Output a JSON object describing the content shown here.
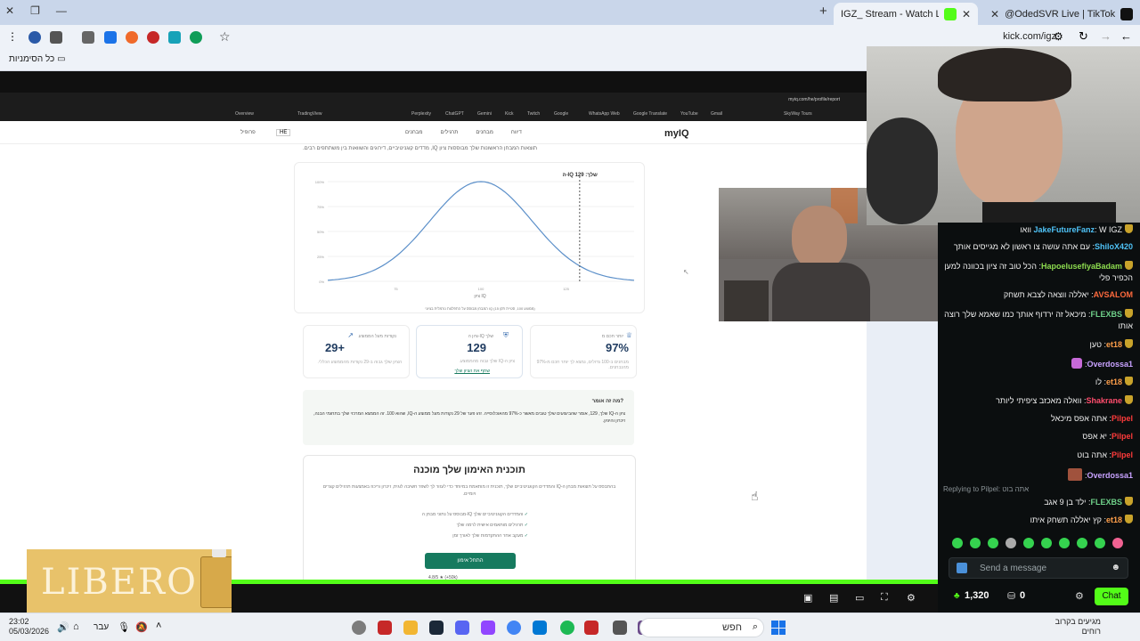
{
  "browser": {
    "tabs": [
      {
        "title": "IGZ_ Stream - Watch Live on Kick",
        "active": true
      },
      {
        "title": "@OdedSVR Live | TikTok",
        "active": false
      }
    ],
    "url": "kick.com/igz",
    "bookmarks_label": "כל הסימניות"
  },
  "shared_screen": {
    "inner_url": "myiq.com/he/profile/report",
    "logo": "myIQ",
    "nav": [
      "דיווח",
      "מבחנים",
      "תרגילים",
      "מבחנים"
    ],
    "lang": "HE",
    "user": "פרופיל",
    "subtitle": "תוצאות המבחן הראשונות שלך מבוססות ציון IQ, מדדים קוגניטיביים, דירוגים והשוואות בין משתתפים רבים.",
    "bookmarks": [
      "Overview",
      "TradingView",
      "Perplexity",
      "ChatGPT",
      "Gemini",
      "Kick",
      "Twitch",
      "Google",
      "WhatsApp Web",
      "Google Translate",
      "YouTube",
      "Gmail",
      "SkyWay Tours"
    ],
    "chart": {
      "score_label": "ה-IQ שלך: 129",
      "y_ticks": [
        "100%",
        "75%",
        "50%",
        "25%",
        "0%"
      ],
      "x_ticks": [
        "75",
        "100",
        "125"
      ],
      "x_label": "ציון IQ",
      "note": "המבחן מבוסס על התפלגות נורמלית בציוני IQ (ממוצע 100, סטיית תקן 15)"
    },
    "chart_data": {
      "type": "line",
      "x": [
        55,
        65,
        75,
        85,
        95,
        100,
        105,
        115,
        125,
        135,
        145
      ],
      "y": [
        0.5,
        2.3,
        7.2,
        17,
        28,
        30,
        28,
        17,
        7.2,
        2.3,
        0.5
      ],
      "xlabel": "ציון IQ",
      "marker_x": 129,
      "marker_label": "ה-IQ שלך: 129"
    },
    "stats": [
      {
        "label": "יותר חכם מ",
        "value": "97%",
        "desc": "מבחנים ב-100 גדולים, נמצא לך יותר חכם מ-97% מהנבחנים."
      },
      {
        "label": "ציון ה-IQ שלך",
        "value": "129",
        "desc": "ציון ה-IQ שלך גבוה מהממוצע.",
        "link": "שתף את הציון שלך"
      },
      {
        "label": "נקודות מעל הממוצע",
        "value": "29+",
        "desc": "הציון שלך גבוה ב-29 נקודות מהממוצע הכללי."
      }
    ],
    "explain_q": "מה זה אומר?",
    "explain_text": "ציון ה-IQ שלך, 129, אומר שהביצועים שלך טובים מאשר כ-97% מהאוכלוסייה. זהו פער של 29 נקודות מעל ממוצע ה-IQ, שהוא 100. זה הממצא המרכזי שלך בתחומי הבנה, זיכרון והיגיון.",
    "plan_title": "תוכנית האימון שלך מוכנה",
    "plan_desc": "בהתבסס על תוצאות מבחן ה-IQ והמדדים הקוגניטיביים שלך, תוכנית זו מותאמת במיוחד כדי לעזור לך לשפר חשיבה לוגית, זיכרון וריכוז באמצעות תרגילים קצרים ויומיים.",
    "plan_features": [
      "מבוסס על נתוני מבחן ה-IQ והמדדים הקוגניטיביים שלך",
      "תרגילים מותאמים אישית לרמה שלך",
      "מעקב אחר ההתקדמות שלך לאורך זמן"
    ],
    "plan_cta": "התחל אימון",
    "plan_rating": "4.8/5 ★ (+50k)"
  },
  "chat": {
    "messages": [
      {
        "user": "JakeFutureFanz",
        "text": "W IGZ וואו",
        "color": "#4fc3f7"
      },
      {
        "user": "ShiloX420",
        "text": "עם אתה עושה צו ראשון לא מגייסים אותך",
        "color": "#4fc3f7"
      },
      {
        "user": "HapoelusefiyaBadam",
        "text": "הכל טוב זה ציון בכוונה למען הכפיר פלי",
        "color": "#8ddc4f"
      },
      {
        "user": "AVSALOM",
        "text": "יאללה ווצאה לצבא תשחק",
        "color": "#ff6a3d"
      },
      {
        "user": "FLEXBS",
        "text": "מיכאל זה ירדוף אותך כמו שאמא שלך רוצה אותו",
        "color": "#6fd18a"
      },
      {
        "user": "et18",
        "text": "טען",
        "color": "#ff9f4a"
      },
      {
        "user": "Overdossa1",
        "text": "",
        "color": "#c8a2ff"
      },
      {
        "user": "et18",
        "text": "לו",
        "color": "#ff9f4a"
      },
      {
        "user": "Shakrane",
        "text": "וואלה מאכזב ציפיתי ליותר",
        "color": "#ff4d6d"
      },
      {
        "user": "Pilpel",
        "text": "אתה אפס מיכאל",
        "color": "#ff3b3b"
      },
      {
        "user": "Pilpel",
        "text": "יא אפס",
        "color": "#ff3b3b"
      },
      {
        "user": "Pilpel",
        "text": "אתה בוט",
        "color": "#ff3b3b"
      },
      {
        "user": "Overdossa1",
        "text": "",
        "color": "#c8a2ff"
      },
      {
        "user": "FLEXBS",
        "text": "ילד בן 9 אגב",
        "color": "#6fd18a"
      },
      {
        "user": "et18",
        "text": "קץ יאללה תשחק איתו",
        "color": "#ff9f4a"
      }
    ],
    "reply_to": "Replying to Pilpel: אתה בוט",
    "send_placeholder": "Send a message",
    "points": "1,320",
    "zero": "0",
    "chat_btn": "Chat"
  },
  "overlay": {
    "ad_word": "LIBERO"
  },
  "taskbar": {
    "time": "23:02",
    "date": "05/03/2026",
    "lang": "עבר",
    "search_placeholder": "חפש",
    "weather": "מגיעים בקרוב",
    "weather_sub": "רוחים"
  },
  "colors": {
    "kick_green": "#53fc18",
    "cta_green": "#167a5f",
    "chat_bg": "#0b0e0f"
  }
}
